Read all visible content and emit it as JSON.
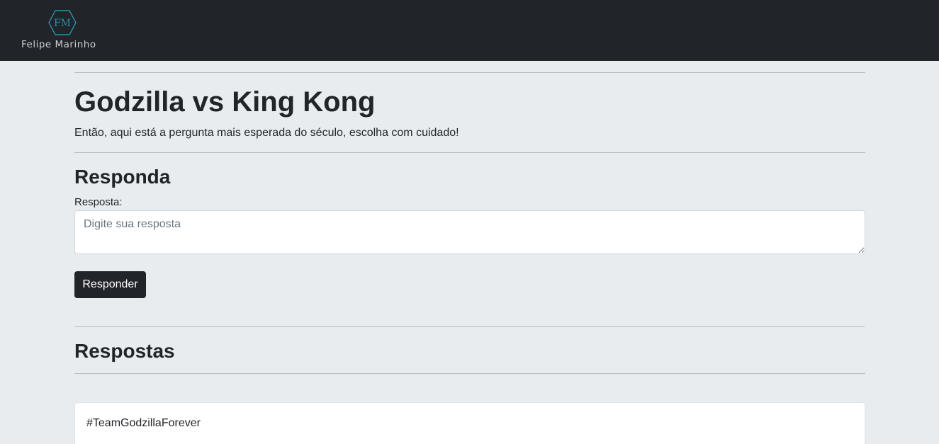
{
  "brand": {
    "monogram": "FM",
    "name": "Felipe Marinho",
    "accent": "#2a8fa8"
  },
  "question": {
    "title": "Godzilla vs King Kong",
    "description": "Então, aqui está a pergunta mais esperada do século, escolha com cuidado!"
  },
  "answer_form": {
    "heading": "Responda",
    "label": "Resposta:",
    "placeholder": "Digite sua resposta",
    "value": "",
    "submit_label": "Responder"
  },
  "answers": {
    "heading": "Respostas",
    "items": [
      {
        "text": "#TeamGodzillaForever"
      }
    ]
  }
}
